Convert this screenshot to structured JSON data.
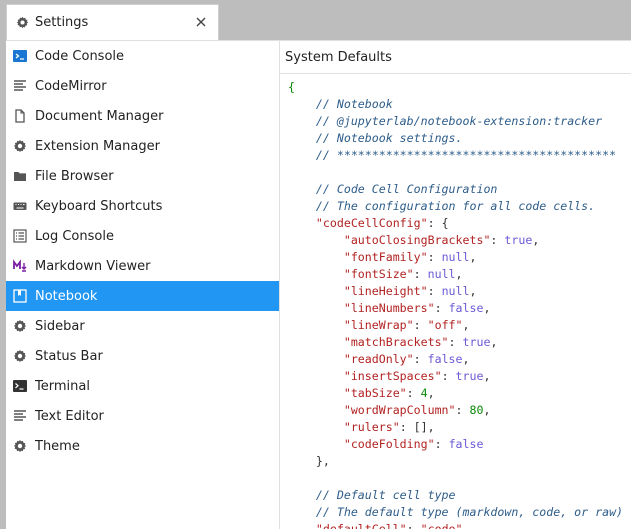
{
  "tab": {
    "title": "Settings"
  },
  "sidebar": {
    "items": [
      {
        "label": "Code Console",
        "icon": "console-icon"
      },
      {
        "label": "CodeMirror",
        "icon": "text-lines-icon"
      },
      {
        "label": "Document Manager",
        "icon": "document-icon"
      },
      {
        "label": "Extension Manager",
        "icon": "gear-icon"
      },
      {
        "label": "File Browser",
        "icon": "folder-icon"
      },
      {
        "label": "Keyboard Shortcuts",
        "icon": "keyboard-icon"
      },
      {
        "label": "Log Console",
        "icon": "list-icon"
      },
      {
        "label": "Markdown Viewer",
        "icon": "markdown-icon"
      },
      {
        "label": "Notebook",
        "icon": "notebook-icon",
        "active": true
      },
      {
        "label": "Sidebar",
        "icon": "gear-icon"
      },
      {
        "label": "Status Bar",
        "icon": "gear-icon"
      },
      {
        "label": "Terminal",
        "icon": "terminal-icon"
      },
      {
        "label": "Text Editor",
        "icon": "text-lines-icon"
      },
      {
        "label": "Theme",
        "icon": "gear-icon"
      }
    ]
  },
  "editor": {
    "title": "System Defaults",
    "lines": [
      [
        [
          "brace",
          "{"
        ]
      ],
      [
        [
          "comment",
          "    // Notebook"
        ]
      ],
      [
        [
          "comment",
          "    // @jupyterlab/notebook-extension:tracker"
        ]
      ],
      [
        [
          "comment",
          "    // Notebook settings."
        ]
      ],
      [
        [
          "comment",
          "    // ****************************************"
        ]
      ],
      [],
      [
        [
          "comment",
          "    // Code Cell Configuration"
        ]
      ],
      [
        [
          "comment",
          "    // The configuration for all code cells."
        ]
      ],
      [
        [
          "key",
          "    \"codeCellConfig\""
        ],
        [
          "punc",
          ": {"
        ]
      ],
      [
        [
          "key",
          "        \"autoClosingBrackets\""
        ],
        [
          "punc",
          ": "
        ],
        [
          "bool",
          "true"
        ],
        [
          "punc",
          ","
        ]
      ],
      [
        [
          "key",
          "        \"fontFamily\""
        ],
        [
          "punc",
          ": "
        ],
        [
          "bool",
          "null"
        ],
        [
          "punc",
          ","
        ]
      ],
      [
        [
          "key",
          "        \"fontSize\""
        ],
        [
          "punc",
          ": "
        ],
        [
          "bool",
          "null"
        ],
        [
          "punc",
          ","
        ]
      ],
      [
        [
          "key",
          "        \"lineHeight\""
        ],
        [
          "punc",
          ": "
        ],
        [
          "bool",
          "null"
        ],
        [
          "punc",
          ","
        ]
      ],
      [
        [
          "key",
          "        \"lineNumbers\""
        ],
        [
          "punc",
          ": "
        ],
        [
          "bool",
          "false"
        ],
        [
          "punc",
          ","
        ]
      ],
      [
        [
          "key",
          "        \"lineWrap\""
        ],
        [
          "punc",
          ": "
        ],
        [
          "str",
          "\"off\""
        ],
        [
          "punc",
          ","
        ]
      ],
      [
        [
          "key",
          "        \"matchBrackets\""
        ],
        [
          "punc",
          ": "
        ],
        [
          "bool",
          "true"
        ],
        [
          "punc",
          ","
        ]
      ],
      [
        [
          "key",
          "        \"readOnly\""
        ],
        [
          "punc",
          ": "
        ],
        [
          "bool",
          "false"
        ],
        [
          "punc",
          ","
        ]
      ],
      [
        [
          "key",
          "        \"insertSpaces\""
        ],
        [
          "punc",
          ": "
        ],
        [
          "bool",
          "true"
        ],
        [
          "punc",
          ","
        ]
      ],
      [
        [
          "key",
          "        \"tabSize\""
        ],
        [
          "punc",
          ": "
        ],
        [
          "num",
          "4"
        ],
        [
          "punc",
          ","
        ]
      ],
      [
        [
          "key",
          "        \"wordWrapColumn\""
        ],
        [
          "punc",
          ": "
        ],
        [
          "num",
          "80"
        ],
        [
          "punc",
          ","
        ]
      ],
      [
        [
          "key",
          "        \"rulers\""
        ],
        [
          "punc",
          ": [],"
        ]
      ],
      [
        [
          "key",
          "        \"codeFolding\""
        ],
        [
          "punc",
          ": "
        ],
        [
          "bool",
          "false"
        ]
      ],
      [
        [
          "punc",
          "    },"
        ]
      ],
      [],
      [
        [
          "comment",
          "    // Default cell type"
        ]
      ],
      [
        [
          "comment",
          "    // The default type (markdown, code, or raw)"
        ]
      ],
      [
        [
          "key",
          "    \"defaultCell\""
        ],
        [
          "punc",
          ": "
        ],
        [
          "str",
          "\"code\""
        ],
        [
          "punc",
          ","
        ]
      ]
    ]
  },
  "colors": {
    "accent": "#2196f3",
    "key": "#b22222",
    "comment": "#2e5d8a",
    "literal": "#6b5bd6",
    "number": "#0a8a0a"
  }
}
